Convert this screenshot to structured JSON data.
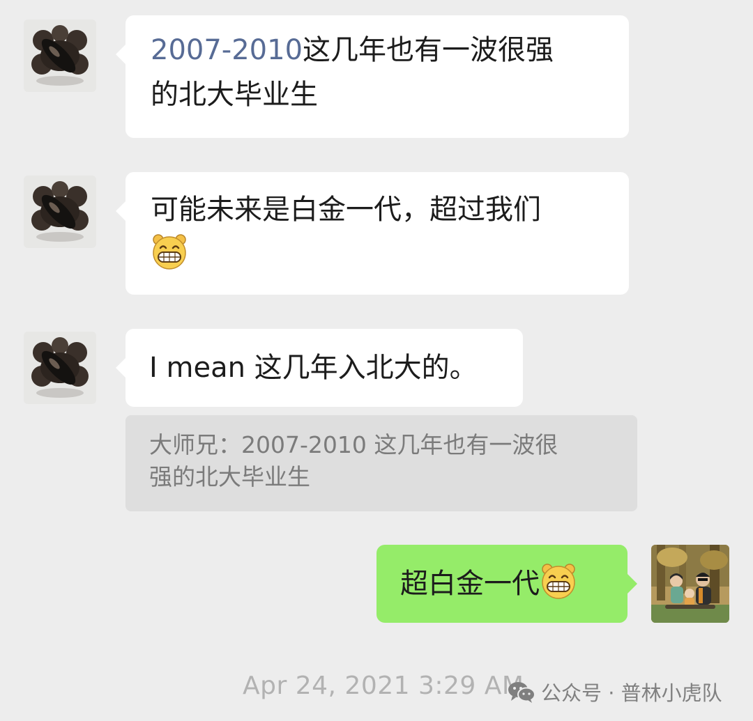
{
  "messages": [
    {
      "sender_side": "left",
      "link_part": "2007-2010",
      "text_part_1": "这几年也有一波很强",
      "text_part_2": "的北大毕业生"
    },
    {
      "sender_side": "left",
      "text_line_1": "可能未来是白金一代，超过我们",
      "emoji": "grin-emoji"
    },
    {
      "sender_side": "left",
      "text": "I mean 这几年入北大的。"
    },
    {
      "sender_side": "right",
      "text": "超白金一代",
      "emoji": "grin-emoji"
    }
  ],
  "quote": {
    "line_1": "大师兄：2007-2010 这几年也有一波很",
    "line_2": "强的北大毕业生"
  },
  "timestamp": "Apr 24, 2021 3:29 AM",
  "watermark": {
    "label": "公众号 · 普林小虎队",
    "icon": "wechat-icon"
  },
  "colors": {
    "background": "#ededed",
    "bubble_incoming": "#ffffff",
    "bubble_outgoing": "#95ec69",
    "link": "#576b95",
    "quote_background": "#dedede"
  }
}
